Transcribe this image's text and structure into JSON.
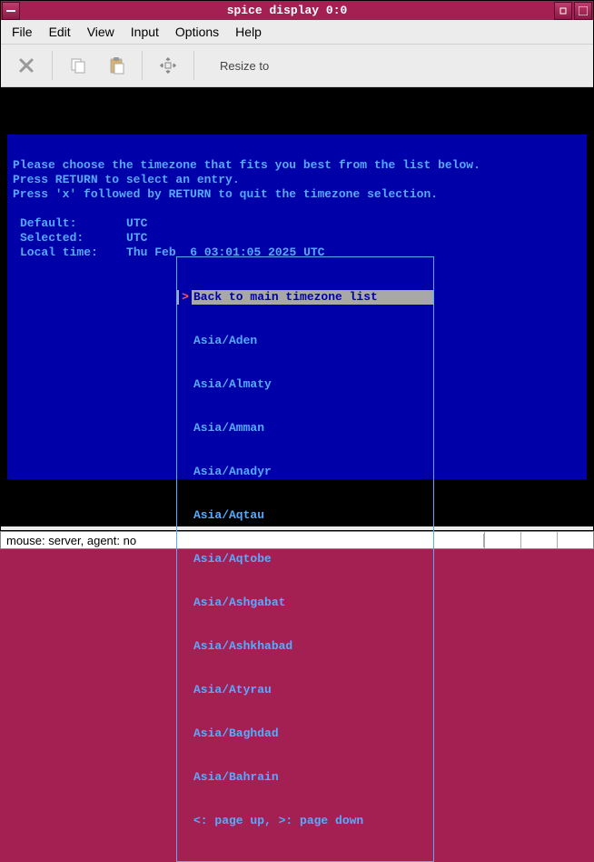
{
  "window": {
    "title": "spice display 0:0"
  },
  "menubar": {
    "file": "File",
    "edit": "Edit",
    "view": "View",
    "input": "Input",
    "options": "Options",
    "help": "Help"
  },
  "toolbar": {
    "resize_label": "Resize to"
  },
  "console": {
    "line1": "Please choose the timezone that fits you best from the list below.",
    "line2": "Press RETURN to select an entry.",
    "line3": "Press 'x' followed by RETURN to quit the timezone selection.",
    "default_label": "Default:",
    "default_value": "UTC",
    "selected_label": "Selected:",
    "selected_value": "UTC",
    "localtime_label": "Local time:",
    "localtime_value": "Thu Feb  6 03:01:05 2025 UTC"
  },
  "listbox": {
    "items": [
      "Back to main timezone list",
      "Asia/Aden",
      "Asia/Almaty",
      "Asia/Amman",
      "Asia/Anadyr",
      "Asia/Aqtau",
      "Asia/Aqtobe",
      "Asia/Ashgabat",
      "Asia/Ashkhabad",
      "Asia/Atyrau",
      "Asia/Baghdad",
      "Asia/Bahrain"
    ],
    "hint": "<: page up, >: page down"
  },
  "statusbar": {
    "text": "mouse: server, agent:  no"
  }
}
